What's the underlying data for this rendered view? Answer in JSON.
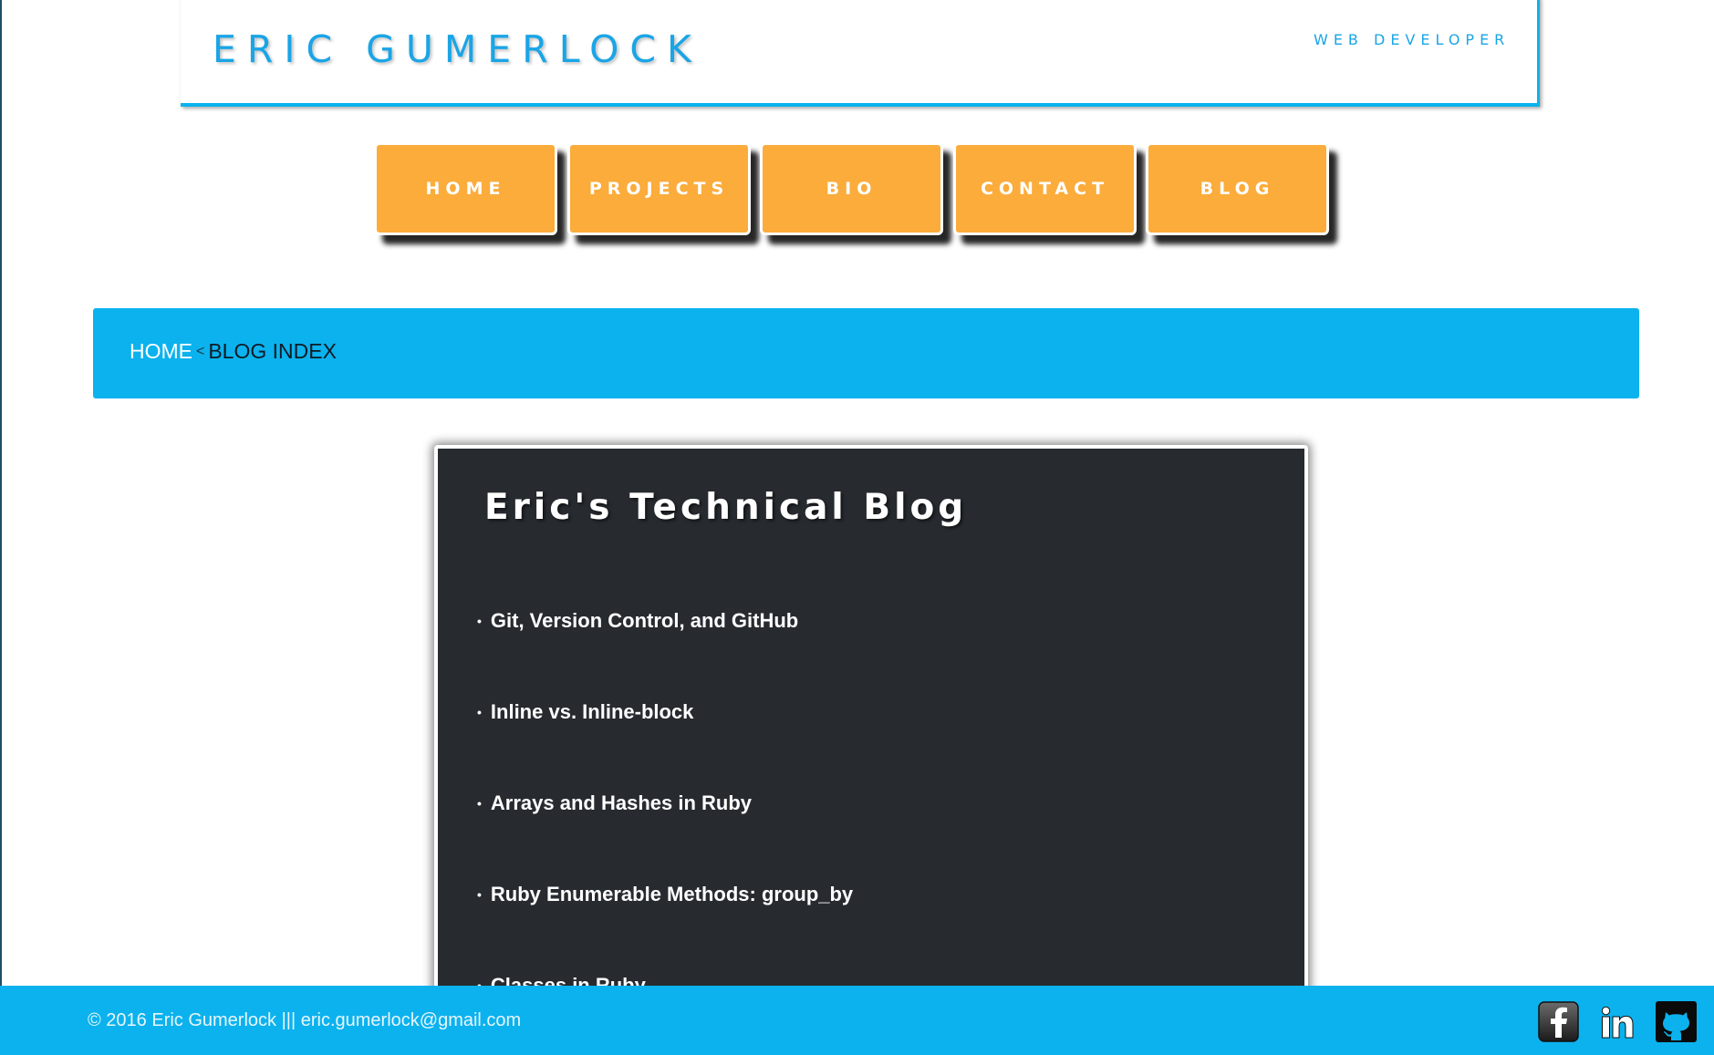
{
  "header": {
    "title": "ERIC GUMERLOCK",
    "subtitle": "WEB DEVELOPER"
  },
  "nav": {
    "items": [
      {
        "label": "HOME"
      },
      {
        "label": "PROJECTS"
      },
      {
        "label": "BIO"
      },
      {
        "label": "CONTACT"
      },
      {
        "label": "BLOG"
      }
    ],
    "accent": "#fbac3b"
  },
  "breadcrumb": {
    "home": "HOME",
    "separator": "<",
    "current": "BLOG INDEX"
  },
  "blog": {
    "title": "Eric's Technical Blog",
    "bullet": "•",
    "posts": [
      {
        "title": "Git, Version Control, and GitHub"
      },
      {
        "title": "Inline vs. Inline-block"
      },
      {
        "title": "Arrays and Hashes in Ruby"
      },
      {
        "title": "Ruby Enumerable Methods: group_by"
      },
      {
        "title": "Classes in Ruby"
      }
    ]
  },
  "footer": {
    "text": "© 2016 Eric Gumerlock ||| eric.gumerlock@gmail.com",
    "social": [
      {
        "icon": "facebook-icon"
      },
      {
        "icon": "linkedin-icon"
      },
      {
        "icon": "github-icon"
      }
    ]
  },
  "colors": {
    "primary_blue": "#0bb2ee",
    "title_blue": "#19a5e6",
    "orange": "#fbac3b",
    "panel_dark": "#272b30"
  }
}
